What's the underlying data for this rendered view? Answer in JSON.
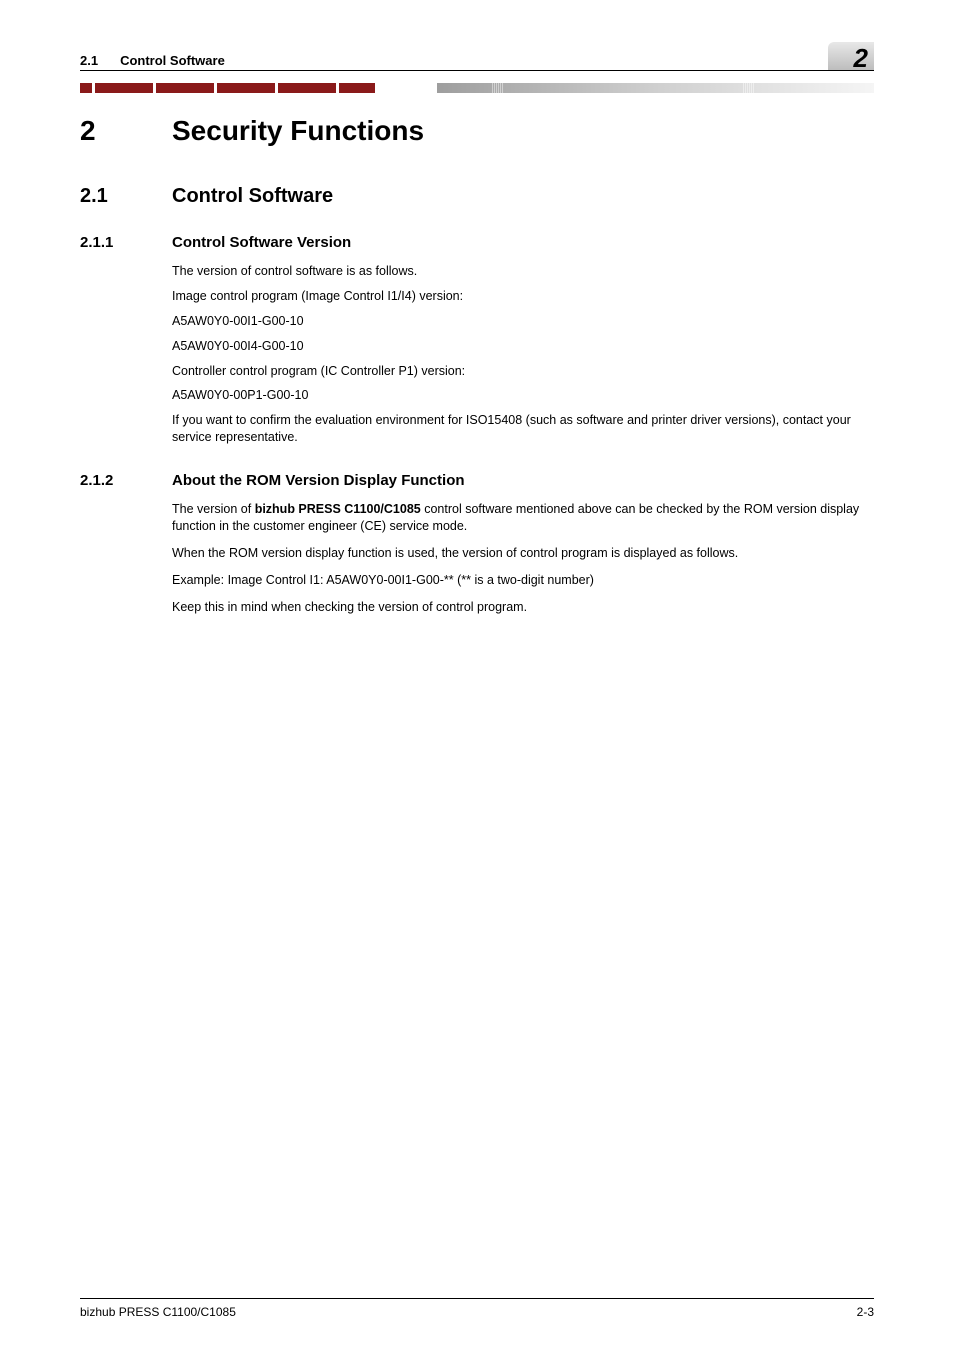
{
  "header": {
    "section_number": "2.1",
    "section_title": "Control Software",
    "chapter_tab": "2"
  },
  "chapter": {
    "number": "2",
    "title": "Security Functions"
  },
  "section": {
    "number": "2.1",
    "title": "Control Software"
  },
  "subsections": [
    {
      "number": "2.1.1",
      "title": "Control Software Version",
      "paragraphs": [
        "The version of control software is as follows.",
        "Image control program (Image Control I1/I4) version:",
        "A5AW0Y0-00I1-G00-10",
        "A5AW0Y0-00I4-G00-10",
        "Controller control program (IC Controller P1) version:",
        "A5AW0Y0-00P1-G00-10",
        "If you want to confirm the evaluation environment for ISO15408 (such as software and printer driver versions), contact your service representative."
      ]
    },
    {
      "number": "2.1.2",
      "title": "About the ROM Version Display Function",
      "paragraphs_rich": [
        {
          "pre": "The version of ",
          "bold": "bizhub PRESS C1100/C1085",
          "post": " control software mentioned above can be checked by the ROM version display function in the customer engineer (CE) service mode."
        },
        {
          "pre": "When the ROM version display function is used, the version of control program is displayed as follows.",
          "bold": "",
          "post": ""
        },
        {
          "pre": "Example: Image Control I1: A5AW0Y0-00I1-G00-** (** is a two-digit number)",
          "bold": "",
          "post": ""
        },
        {
          "pre": "Keep this in mind when checking the version of control program.",
          "bold": "",
          "post": ""
        }
      ]
    }
  ],
  "footer": {
    "left": "bizhub PRESS C1100/C1085",
    "right": "2-3"
  }
}
